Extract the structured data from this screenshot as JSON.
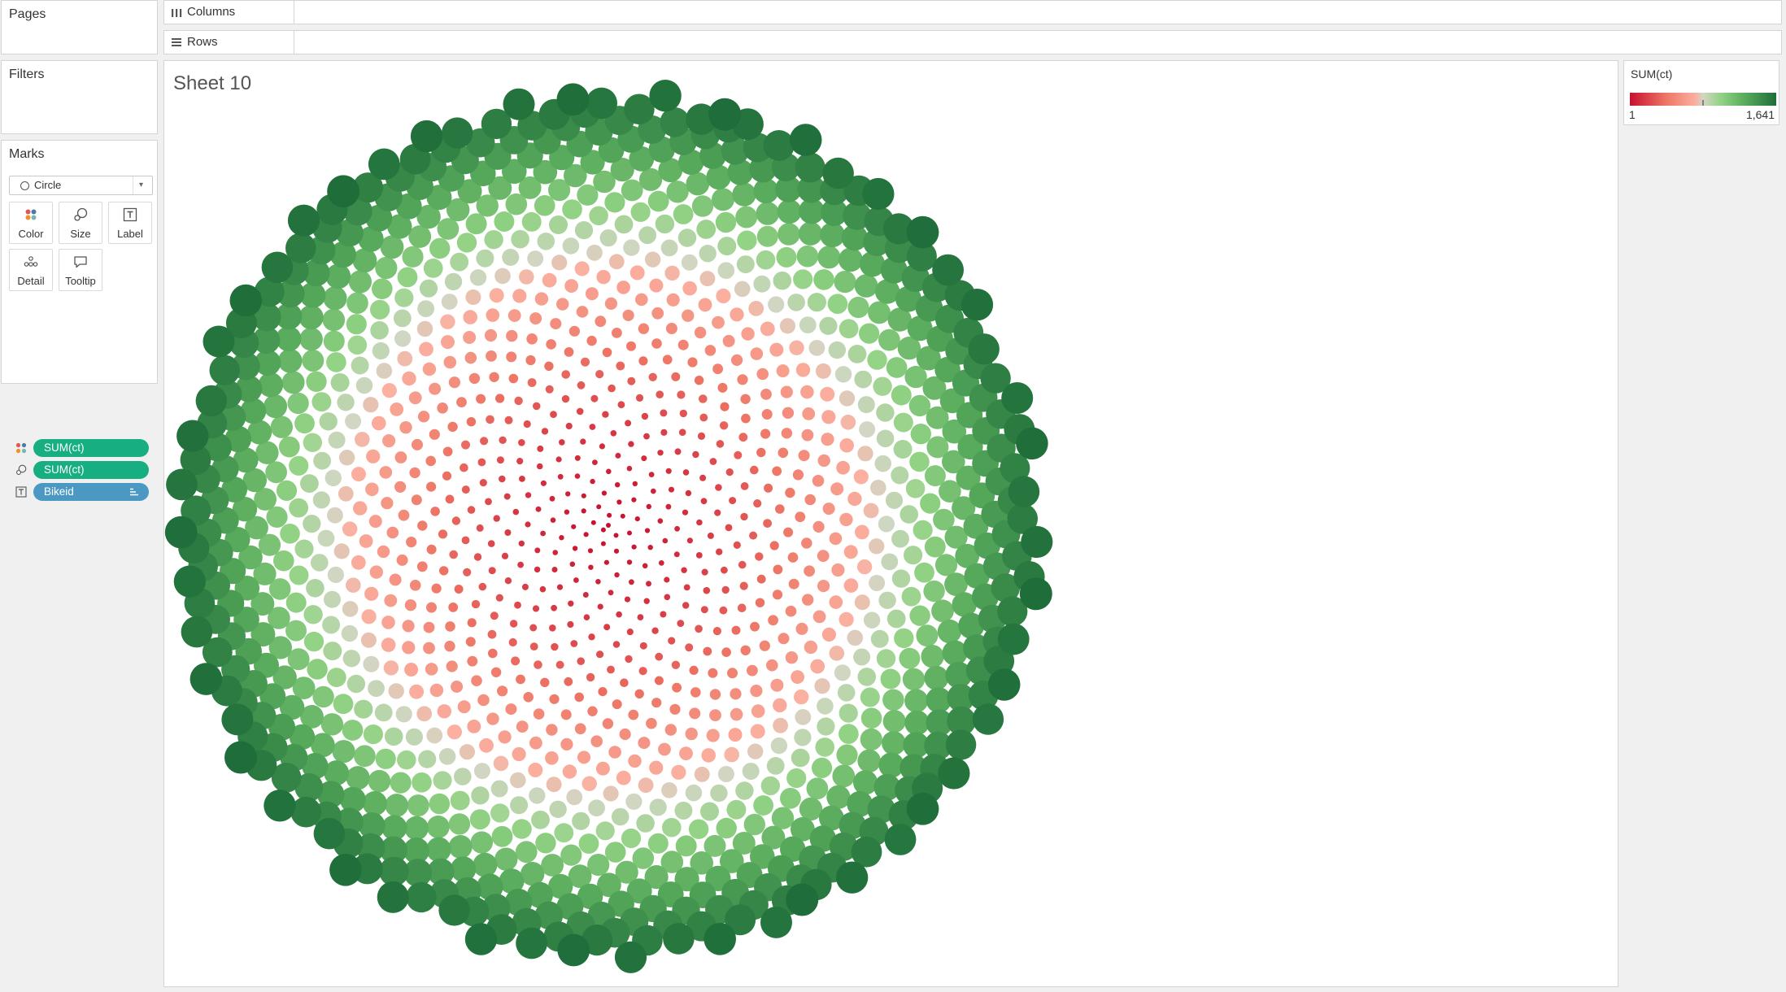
{
  "panels": {
    "pages_title": "Pages",
    "filters_title": "Filters",
    "marks_title": "Marks"
  },
  "marks": {
    "mark_type": "Circle",
    "buttons": {
      "color": "Color",
      "size": "Size",
      "label": "Label",
      "detail": "Detail",
      "tooltip": "Tooltip"
    },
    "pills": [
      {
        "encoding": "color",
        "field": "SUM(ct)"
      },
      {
        "encoding": "size",
        "field": "SUM(ct)"
      },
      {
        "encoding": "label",
        "field": "Bikeid"
      }
    ]
  },
  "shelves": {
    "columns_label": "Columns",
    "rows_label": "Rows"
  },
  "sheet": {
    "title": "Sheet 10"
  },
  "legend": {
    "title": "SUM(ct)",
    "min": "1",
    "max": "1,641",
    "palette": [
      "#c8102e",
      "#ee7766",
      "#fbb0a0",
      "#d2d6c4",
      "#93d385",
      "#55a85a",
      "#1e6d3a"
    ]
  },
  "colors": {
    "pill_measure": "#17ae82",
    "pill_dimension": "#4b99c3"
  },
  "chart_data": {
    "type": "scatter",
    "layout": "phyllotaxis spiral (packed circles)",
    "mark_count_estimate": 1641,
    "color_measure": "SUM(ct)",
    "size_measure": "SUM(ct)",
    "label_field": "Bikeid",
    "value_range": [
      1,
      1641
    ],
    "title": "Sheet 10"
  }
}
